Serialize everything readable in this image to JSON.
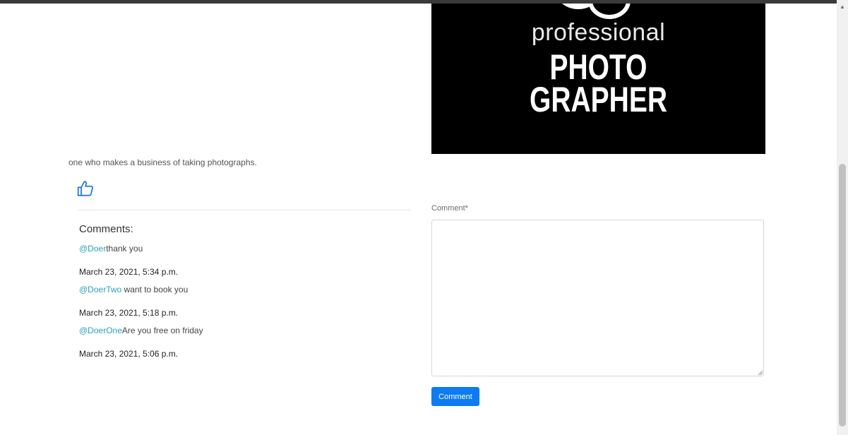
{
  "post": {
    "image_text": {
      "line1": "professional",
      "line2": "PHOTO",
      "line3": "GRAPHER"
    },
    "description": "one who makes a business of taking photographs."
  },
  "comments_section": {
    "heading": "Comments:",
    "comments": [
      {
        "mention": "@Doer",
        "text": "thank you",
        "date": "March 23, 2021, 5:34 p.m."
      },
      {
        "mention": "@DoerTwo",
        "text": " want to book you",
        "date": "March 23, 2021, 5:18 p.m."
      },
      {
        "mention": "@DoerOne",
        "text": "Are you free on friday",
        "date": "March 23, 2021, 5:06 p.m."
      }
    ]
  },
  "comment_form": {
    "label": "Comment*",
    "value": "",
    "placeholder": "",
    "submit_label": "Comment"
  },
  "icons": {
    "like": "thumbs-up-icon",
    "scroll_up": "scroll-up-arrow-icon"
  },
  "colors": {
    "mention": "#2aa1b7",
    "button": "#0d7bf2",
    "like_icon": "#1a73e8"
  }
}
